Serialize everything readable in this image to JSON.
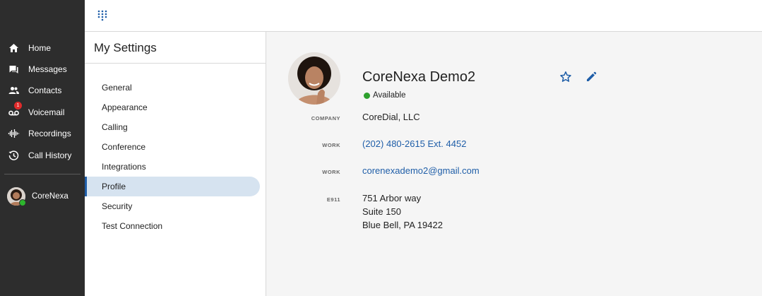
{
  "sidebar": {
    "items": [
      {
        "label": "Home",
        "icon": "home-icon"
      },
      {
        "label": "Messages",
        "icon": "messages-icon"
      },
      {
        "label": "Contacts",
        "icon": "contacts-icon"
      },
      {
        "label": "Voicemail",
        "icon": "voicemail-icon",
        "badge": "1"
      },
      {
        "label": "Recordings",
        "icon": "recordings-icon"
      },
      {
        "label": "Call History",
        "icon": "history-icon"
      }
    ],
    "user": {
      "label": "CoreNexa",
      "status_color": "#2db52d"
    }
  },
  "settings": {
    "title": "My Settings",
    "menu": [
      "General",
      "Appearance",
      "Calling",
      "Conference",
      "Integrations",
      "Profile",
      "Security",
      "Test Connection"
    ],
    "active": "Profile"
  },
  "profile": {
    "name": "CoreNexa Demo2",
    "status": "Available",
    "status_color": "#2da02d",
    "fields": {
      "company_label": "COMPANY",
      "company": "CoreDial, LLC",
      "work_phone_label": "WORK",
      "work_phone": "(202) 480-2615 Ext. 4452",
      "work_email_label": "WORK",
      "work_email": "corenexademo2@gmail.com",
      "e911_label": "E911",
      "e911_line1": "751 Arbor way",
      "e911_line2": "Suite 150",
      "e911_line3": "Blue Bell, PA 19422"
    }
  },
  "colors": {
    "accent": "#1f5ea8",
    "sidebar_bg": "#2d2d2d",
    "active_bg": "#d6e3f0"
  }
}
